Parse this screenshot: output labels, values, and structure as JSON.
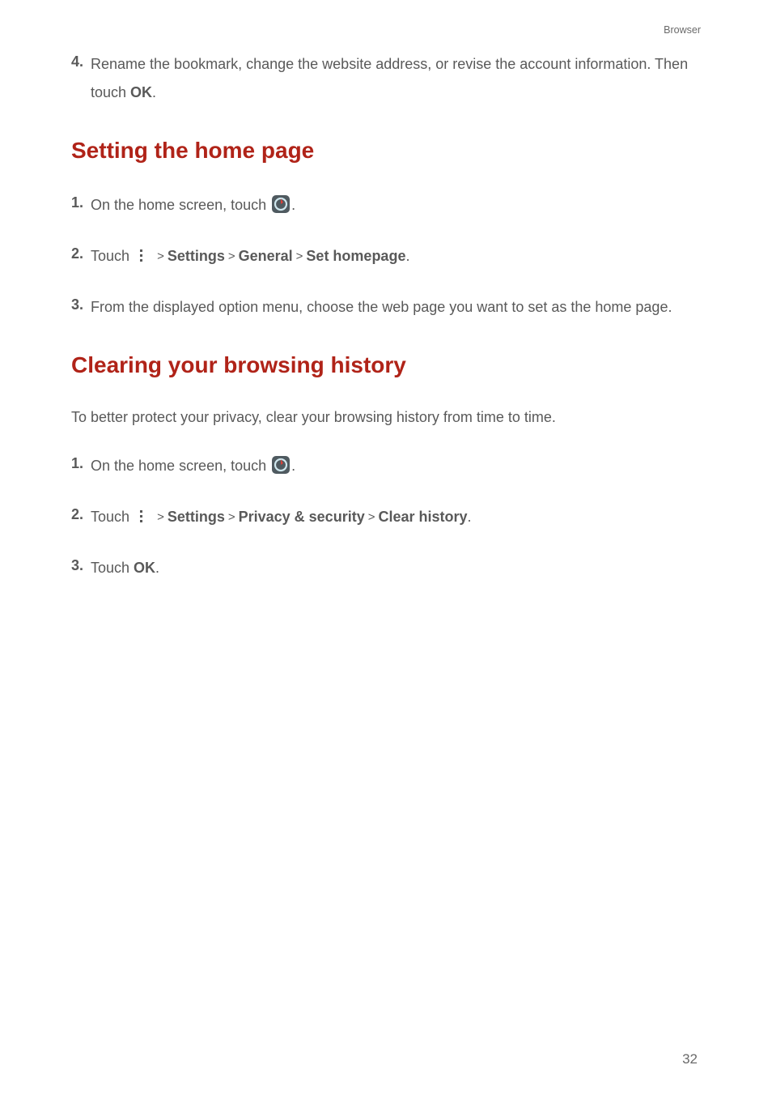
{
  "header": {
    "section_label": "Browser"
  },
  "prev_section": {
    "step4": {
      "num": "4.",
      "text_a": "Rename the bookmark, change the website address, or revise the account information. Then touch ",
      "ok": "OK",
      "period": "."
    }
  },
  "section_homepage": {
    "title": "Setting the home page",
    "step1": {
      "num": "1.",
      "text_a": "On the home screen, touch ",
      "period": "."
    },
    "step2": {
      "num": "2.",
      "text_a": "Touch ",
      "settings": "Settings",
      "general": "General",
      "set_homepage": "Set homepage",
      "period": "."
    },
    "step3": {
      "num": "3.",
      "text": "From the displayed option menu, choose the web page you want to set as the home page."
    }
  },
  "section_clear": {
    "title": "Clearing your browsing history",
    "intro": "To better protect your privacy, clear your browsing history from time to time.",
    "step1": {
      "num": "1.",
      "text_a": "On the home screen, touch ",
      "period": "."
    },
    "step2": {
      "num": "2.",
      "text_a": "Touch ",
      "settings": "Settings",
      "privacy": "Privacy & security",
      "clear_history": "Clear history",
      "period": "."
    },
    "step3": {
      "num": "3.",
      "text_a": "Touch ",
      "ok": "OK",
      "period": "."
    }
  },
  "page_number": "32"
}
